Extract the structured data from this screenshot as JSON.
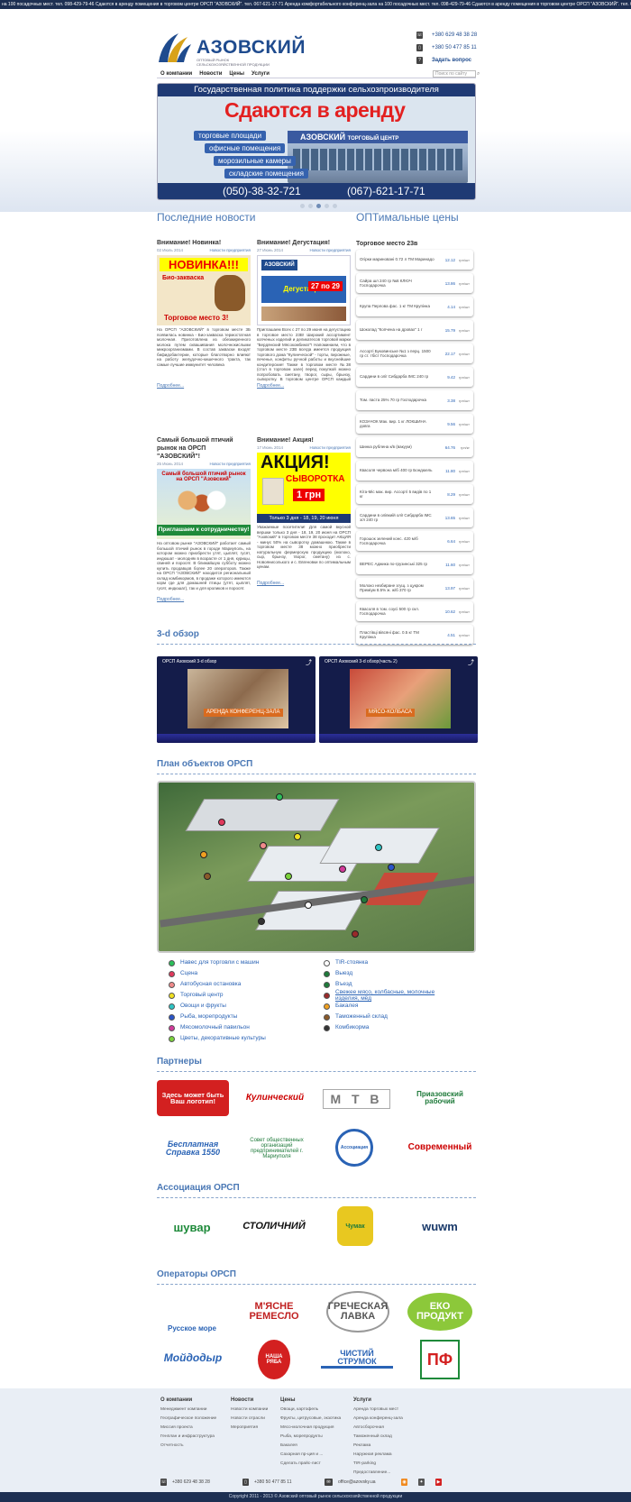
{
  "ticker": "на 100 посадочных мест. тел. 098-429-79-46   Сдаются в аренду помещения в торговом центре ОРСП \"АЗОВСКИЙ\". тел. 067-621-17-71   Аренда комфортабельного конференц-зала на 100 посадочных мест. тел. 098-429-79-46   Сдаются в аренду помещения в торговом центре ОРСП \"АЗОВСКИЙ\". тел. 067-621-17-71",
  "logo": {
    "name": "АЗОВСКИЙ",
    "sub": "ОПТОВЫЙ РЫНОК СЕЛЬСКОХОЗЯЙСТВЕННОЙ ПРОДУКЦИИ"
  },
  "contacts": {
    "phone1": "+380 629 48 38 28",
    "phone2": "+380 50 477 85 11",
    "ask": "Задать вопрос"
  },
  "nav": [
    "О компании",
    "Новости",
    "Цены",
    "Услуги"
  ],
  "search_placeholder": "Поиск по сайту",
  "banner": {
    "strip": "Государственная политика поддержки сельхозпроизводителя",
    "title": "Сдаются в аренду",
    "labels": [
      "торговые площади",
      "офисные помещения",
      "морозильные камеры",
      "складские помещения"
    ],
    "building": "АЗОВСКИЙ",
    "building_sub": "ТОРГОВЫЙ ЦЕНТР",
    "phone1": "(050)-38-32-721",
    "phone2": "(067)-621-17-71"
  },
  "sections": {
    "news": "Последние новости",
    "prices": "ОПТимальные цены",
    "overview": "3-d обзор",
    "plan": "План объектов ОРСП",
    "partners": "Партнеры",
    "association": "Ассоциация ОРСП",
    "operators": "Операторы ОРСП"
  },
  "news": [
    {
      "title": "Внимание! Новинка!",
      "date": "02 Июль 2014",
      "cat": "Новости предприятия",
      "img_lines": [
        "НОВИНКА!!!",
        "Био-закваска",
        "Торговое место 3!"
      ],
      "text": "На ОРСП \"АЗОВСКИЙ\" в торговом месте 3Б появилась новинка - Био-закваска термостатная молочная. Приготовлена из обезжиренного молока путем сквашивания молочнокислыми микроорганизмами. В состав закваски входят бифидобактерии, которые благотворно влияют на работу желудочно-кишечного тракта, так самые лучшие иммунитет человека",
      "more": "Подробнее..."
    },
    {
      "title": "Внимание! Дегустация!",
      "date": "27 Июнь 2014",
      "cat": "Новости предприятия",
      "img_lines": [
        "АЗОВСКИЙ",
        "Дегустация",
        "27 по 29"
      ],
      "text": "Приглашаем Всех с 27 по 29 июня на дегустацию в торговое место 23В! Широкий ассортимент копченых изделий и деликатесов торговой марки \"Бердянский Мясокомбинат\"! Напоминаем, что в торговом месте 23В всегда имеется продукция торгового дома \"Кулинческой\" - торты, пирожные, печенье, конфеты ручной работы и вкуснейшие кондитерские! Также в торговом месте №38 (стол в торговом зале) перед покупкой можно попробовать сметану, творог, сыры, брынзу, сыворотку. В торговом центре ОРСП каждый посетитель ОРСП \"АЗОВСКИЙ\" может убедиться сам!",
      "more": "Подробнее..."
    },
    {
      "title": "Самый большой птичий рынок на ОРСП \"АЗОВСКИЙ\"!",
      "date": "25 Июнь 2014",
      "cat": "Новости предприятия",
      "img_lines": [
        "Самый большой птичий рынок на ОРСП \"Азовский\"",
        "Приглашаем к сотрудничеству!"
      ],
      "text": "На оптовом рынке \"АЗОВСКИЙ\" работает самый большой птичий рынок в городе Мариуполь, на котором можно приобрести утят, цыплят, гусят, индюшат - молодняк в возрасте от 1 дня, курицы, свиней и поросят. В ближайшую субботу можно купить продавцов более 20 операторов. Также на ОРСП \"АЗОВСКИЙ\" находится региональный склад комбикормов, в продаже которого имеются корм где для домашней птицы (утят, цыплят, гусят, индюшат), так и для кроликов и поросят.",
      "more": "Подробнее..."
    },
    {
      "title": "Внимание! Акция!",
      "date": "17 Июнь 2014",
      "cat": "Новости предприятия",
      "img_lines": [
        "АКЦИЯ!",
        "СЫВОРОТКА",
        "1 грн",
        "Только 3 дня - 18, 19, 20 июня"
      ],
      "text": "Уважаемые посетители! Для самой вкусной вершки только 3 дня - 18, 19, 20 июня на ОРСП \"Азовский\" в торговом месте 38 проходит АКЦИЯ - минус 50% на сыворотку домашнюю. Также в торговом месте 38 можно приобрести натуральную фермерскую продукцию (молоко, сыр, брынзу, творог, сметану) из с. Новоянисолького и с. Евгеновки по оптимальным ценам.",
      "more": "Подробнее..."
    }
  ],
  "prices_title": "Торговое место 23в",
  "prices": [
    {
      "name": "Огірки мариновані 0.72 л ТМ Маринадо",
      "value": "12.12",
      "unit": "грн/шт"
    },
    {
      "name": "Сайра шл 240 гр №6 КЛЮЧ Господарочка",
      "value": "13.86",
      "unit": "грн/шт"
    },
    {
      "name": "Крупа Перлова фас. 1 кг ТМ Крупінка",
      "value": "4.14",
      "unit": "грн/шт"
    },
    {
      "name": "Шоколад \"Копчена на дровах\" 1 г",
      "value": "15.79",
      "unit": "грн/шт"
    },
    {
      "name": "Ассорті Буковинське №1 з перц. 1500 гр ст. тбіст Господарочка",
      "value": "22.17",
      "unit": "грн/шт"
    },
    {
      "name": "Сардини в олії Сибдарба IMC 240 гр",
      "value": "9.42",
      "unit": "грн/шт"
    },
    {
      "name": "Том. паста 25% 70 гр Господарочка",
      "value": "3.38",
      "unit": "грн/шт"
    },
    {
      "name": "КОЗАЧОК Мак. вир. 1 кг ЛОКШИНА довга",
      "value": "9.56",
      "unit": "грн/шт"
    },
    {
      "name": "Шинка рублена к/в (вакуум)",
      "value": "64.76",
      "unit": "грн/кг"
    },
    {
      "name": "Квасоля червона м/б 400 гр Бондюель",
      "value": "11.80",
      "unit": "грн/шт"
    },
    {
      "name": "Кіта-Міс мак. вир. Ассорті 5 видів по 1 кг",
      "value": "8.29",
      "unit": "грн/шт"
    },
    {
      "name": "Сардини в олівкиій олії Сибдарба IMC з/л 240 гр",
      "value": "13.65",
      "unit": "грн/шт"
    },
    {
      "name": "Горошок зелений конс. 420 м/б Господарочка",
      "value": "6.64",
      "unit": "грн/шт"
    },
    {
      "name": "ВЕРЕС Аджика по-грузинські 325 гр",
      "value": "11.60",
      "unit": "грн/шт"
    },
    {
      "name": "Молоко незбиране згущ. з цукром Премiум 8.5% ж. ж/б 370 гр",
      "value": "13.97",
      "unit": "грн/шт"
    },
    {
      "name": "Квасоля в том. соусі 500 гр скл. Господарочка",
      "value": "10.62",
      "unit": "грн/шт"
    },
    {
      "name": "Пластівці вівсяні фас. 0.5 кг ТМ Крупінка",
      "value": "4.51",
      "unit": "грн/шт"
    }
  ],
  "videos": [
    {
      "title": "ОРСП Азовский 3-d обзор",
      "label": "АРЕНДА КОНФЕРЕНЦ-ЗАЛА"
    },
    {
      "title": "ОРСП Азовский 3-d обзор(часть 2)",
      "label": "МЯСО-КОЛБАСА"
    }
  ],
  "legend_left": [
    {
      "label": "Навес для торговли с машин",
      "color": "#2bbf5a"
    },
    {
      "label": "Сцена",
      "color": "#e0395c"
    },
    {
      "label": "Автобусная остановка",
      "color": "#f08a8a"
    },
    {
      "label": "Торговый центр",
      "color": "#f0e020"
    },
    {
      "label": "Овощи и фрукты",
      "color": "#2ec4c4"
    },
    {
      "label": "Рыба, морепродукты",
      "color": "#2a55c8"
    },
    {
      "label": "Мясомолочный павильон",
      "color": "#d23a9a"
    },
    {
      "label": "Цветы, декоративные культуры",
      "color": "#7ad23a"
    }
  ],
  "legend_right": [
    {
      "label": "TIR-стоянка",
      "color": "#ffffff"
    },
    {
      "label": "Выезд",
      "color": "#1e7a3a"
    },
    {
      "label": "Въезд",
      "color": "#1e7a3a"
    },
    {
      "label": "Свежее мясо, колбасные, молочные изделия, мёд",
      "color": "#9a2a2a"
    },
    {
      "label": "Бакалея",
      "color": "#f0a020"
    },
    {
      "label": "Таможенный склад",
      "color": "#8a5a2a"
    },
    {
      "label": "Комбикорма",
      "color": "#333333"
    }
  ],
  "partners": [
    "Здесь может быть Ваш логотип!",
    "Кулинческий",
    "М Т В",
    "Приазовский рабочий",
    "Бесплатная Справка 1550",
    "Совет общественных организаций предпринимателей г. Мариуполя",
    "Ассоциация",
    "Современный"
  ],
  "association": [
    "шувар",
    "СТОЛИЧНИЙ",
    "Чумак",
    "wuwm"
  ],
  "operators": [
    "Русское море",
    "М'ЯСНЕ РЕМЕСЛО",
    "ГРЕЧЕСКАЯ ЛАВКА",
    "ЕКО ПРОДУКТ",
    "Мойдодыр",
    "НАША РЯБА",
    "ЧИСТИЙ СТРУМОК",
    "ПФ"
  ],
  "footer": {
    "cols": [
      {
        "head": "О компании",
        "items": [
          "Менеджмент компании",
          "Географическое положение",
          "Миссия проекта",
          "Генплан и инфраструктура",
          "Отчетность"
        ]
      },
      {
        "head": "Новости",
        "items": [
          "Новости компании",
          "Новости отрасли",
          "Мероприятия"
        ]
      },
      {
        "head": "Цены",
        "items": [
          "Овощи, картофель",
          "Фрукты, цитрусовые, экзотика",
          "Мясо-молочная продукция",
          "Рыба, морепродукты",
          "Бакалея",
          "Сахарная пр-ция и ...",
          "Сделать прайс-лист"
        ]
      },
      {
        "head": "Услуги",
        "items": [
          "Аренда торговых мест",
          "Аренда конференц-зала",
          "Автосборочная",
          "Таможенный склад",
          "Реклама",
          "Наружная реклама",
          "TIR-parking",
          "Предоставление..."
        ]
      }
    ],
    "phone1": "+380 629 48 38 28",
    "phone2": "+380 50 477 85 11",
    "email": "office@azovsky.ua",
    "copyright": "Copyright 2011 - 2013 © Азовский оптовый рынок сельскохозяйственной продукции"
  }
}
